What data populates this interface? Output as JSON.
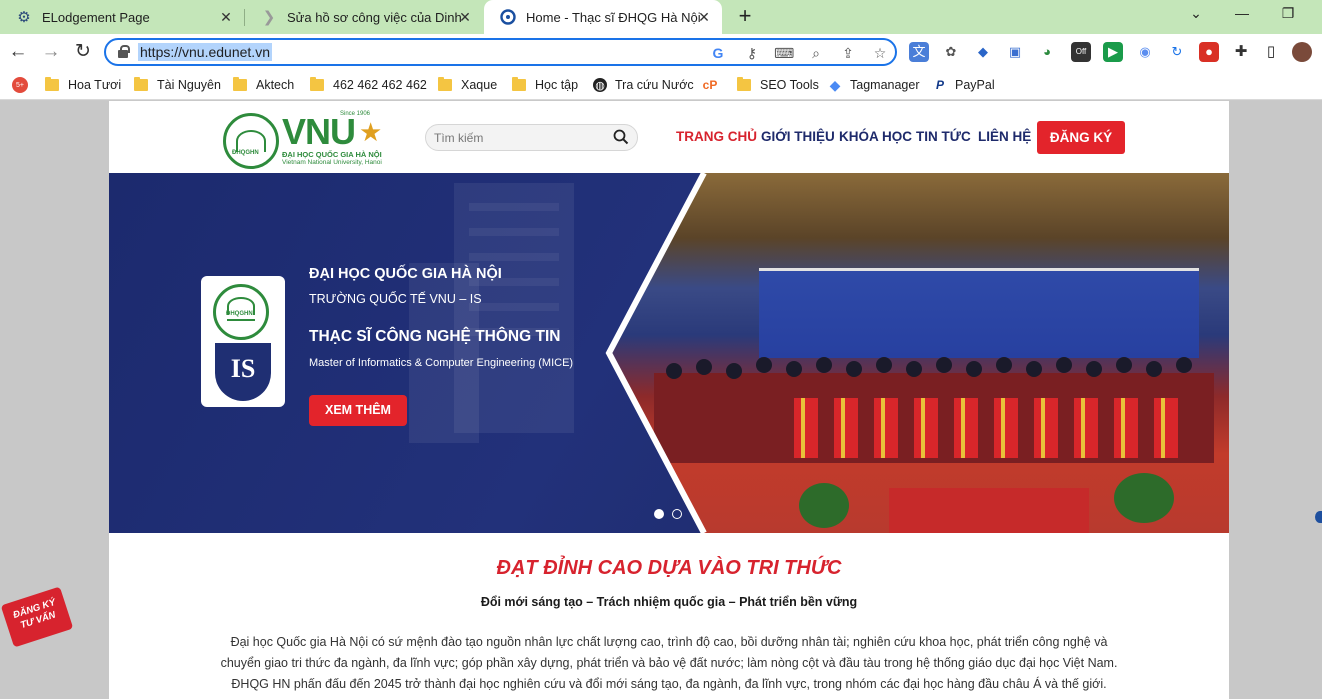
{
  "browser": {
    "tabs": [
      {
        "title": "ELodgement Page",
        "active": false
      },
      {
        "title": "Sửa hồ sơ công việc của Dinh Van",
        "active": false
      },
      {
        "title": "Home - Thạc sĩ ĐHQG Hà Nội",
        "active": true
      }
    ],
    "new_tab": "+",
    "url": "https://vnu.edunet.vn"
  },
  "bookmarks": {
    "items": [
      {
        "label": "Hoa Tươi",
        "icon": "folder-icon"
      },
      {
        "label": "Tài Nguyên",
        "icon": "folder-icon"
      },
      {
        "label": "Aktech",
        "icon": "folder-icon"
      },
      {
        "label": "462 462 462 462",
        "icon": "folder-icon"
      },
      {
        "label": "Xaque",
        "icon": "folder-icon"
      },
      {
        "label": "Học tập",
        "icon": "folder-icon"
      },
      {
        "label": "Tra cứu Nước",
        "icon": "globe-icon"
      },
      {
        "label": "SEO Tools",
        "icon": "folder-icon"
      },
      {
        "label": "Tagmanager",
        "icon": "tagmanager-icon"
      },
      {
        "label": "PayPal",
        "icon": "paypal-icon"
      }
    ]
  },
  "site": {
    "logo": {
      "brand": "VNU",
      "since": "Since 1906",
      "line1": "ĐẠI HỌC QUỐC GIA HÀ NỘI",
      "line2": "Vietnam National University, Hanoi",
      "emblem_text": "ĐHQGHN"
    },
    "search": {
      "placeholder": "Tìm kiếm"
    },
    "nav": {
      "items": [
        {
          "label": "TRANG CHỦ",
          "active": true
        },
        {
          "label": "GIỚI THIỆU",
          "active": false
        },
        {
          "label": "KHÓA HỌC",
          "active": false
        },
        {
          "label": "TIN TỨC",
          "active": false
        },
        {
          "label": "LIÊN HỆ",
          "active": false
        }
      ],
      "register": "ĐĂNG KÝ"
    },
    "hero": {
      "title1": "ĐẠI HỌC QUỐC GIA HÀ NỘI",
      "title2": "TRƯỜNG QUỐC TẾ VNU – IS",
      "title3": "THẠC SĨ CÔNG NGHỆ THÔNG TIN",
      "title4": "Master of Informatics & Computer Engineering (MICE)",
      "cta": "XEM THÊM",
      "card_emblem": "ĐHQGHN",
      "card_shield": "IS",
      "slides_total": 2,
      "slide_active": 1
    },
    "slogan": "ĐẠT ĐỈNH CAO DỰA VÀO TRI THỨC",
    "subslogan": "Đổi mới sáng tạo – Trách nhiệm quốc gia – Phát triển bền vững",
    "paragraph": [
      "Đại học Quốc gia Hà Nội có sứ mệnh đào tạo nguồn nhân lực chất lượng cao, trình độ cao, bồi dưỡng nhân tài; nghiên cứu khoa học, phát triển công nghệ và",
      "chuyển giao tri thức đa ngành, đa lĩnh vực; góp phần xây dựng, phát triển và bảo vệ đất nước; làm nòng cột và đầu tàu trong hệ thống giáo dục đại học Việt Nam.",
      "ĐHQG HN phấn đấu đến 2045 trở thành đại học nghiên cứu và đổi mới sáng tạo, đa ngành, đa lĩnh vực, trong nhóm các đại học hàng đầu châu Á và thế giới."
    ],
    "side_badge": [
      "ĐĂNG KÝ",
      "TƯ VẤN"
    ]
  },
  "colors": {
    "tabbar": "#c4e6b9",
    "accent_red": "#e3242b",
    "nav_blue": "#1e2a6b",
    "vnu_green": "#2e8b3c",
    "hero_blue": "#1c2a6e"
  }
}
